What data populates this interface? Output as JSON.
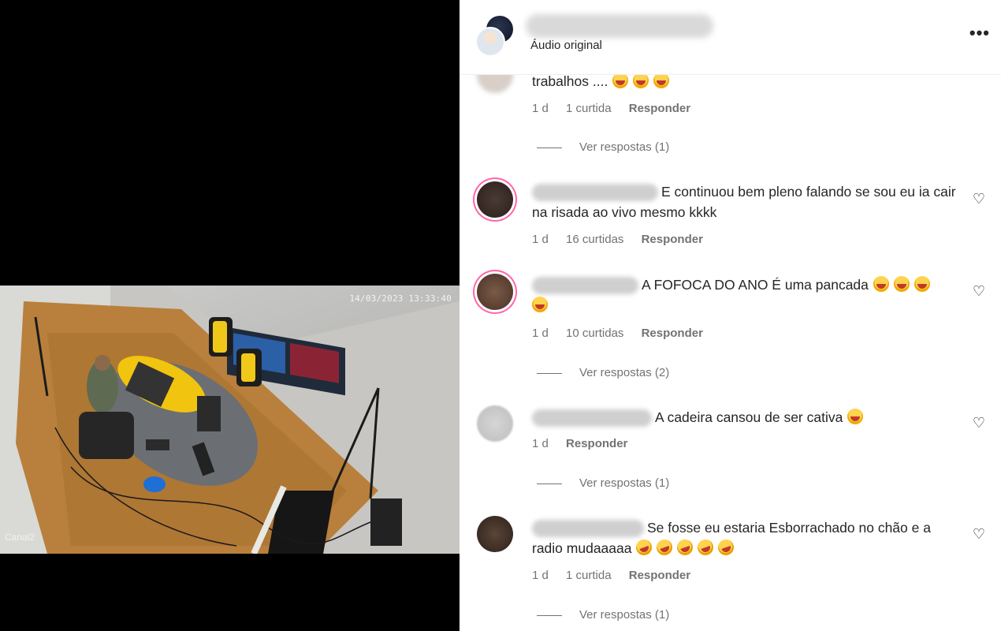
{
  "media": {
    "timestamp": "14/03/2023 13:33:40",
    "channel_label": "Canal2"
  },
  "header": {
    "subtitle": "Áudio original",
    "more_label": "•••"
  },
  "comments": [
    {
      "text": "trabalhos ....",
      "emoji_count": 3,
      "time": "1 d",
      "likes": "1 curtida",
      "reply": "Responder",
      "view_replies": "Ver respostas (1)"
    },
    {
      "text": "E continuou bem pleno falando se sou eu ia cair na risada ao vivo mesmo kkkk",
      "time": "1 d",
      "likes": "16 curtidas",
      "reply": "Responder"
    },
    {
      "text": "A FOFOCA DO ANO É uma pancada",
      "time": "1 d",
      "likes": "10 curtidas",
      "reply": "Responder",
      "view_replies": "Ver respostas (2)"
    },
    {
      "text": "A cadeira cansou de ser cativa",
      "time": "1 d",
      "reply": "Responder",
      "view_replies": "Ver respostas (1)"
    },
    {
      "text": "Se fosse eu estaria Esborrachado no chão e a radio mudaaaaa",
      "time": "1 d",
      "likes": "1 curtida",
      "reply": "Responder",
      "view_replies": "Ver respostas (1)"
    }
  ]
}
